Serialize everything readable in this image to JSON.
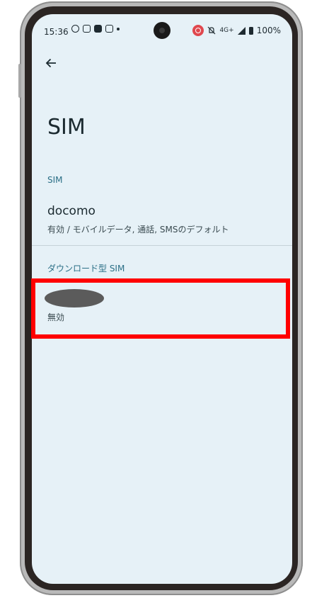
{
  "status_bar": {
    "time": "15:36",
    "network": "4G+",
    "battery": "100%",
    "left_icons": [
      "location-icon",
      "docomo-d-icon",
      "teams-icon",
      "docomo-d-icon",
      "dot-icon"
    ],
    "right_icons": [
      "screen-record-icon",
      "alarm-off-icon",
      "signal-icon",
      "battery-icon"
    ]
  },
  "header": {
    "back_icon": "arrow-left-icon",
    "title": "SIM"
  },
  "sections": [
    {
      "header": "SIM",
      "items": [
        {
          "title": "docomo",
          "subtitle": "有効 / モバイルデータ, 通話, SMSのデフォルト"
        }
      ]
    },
    {
      "header": "ダウンロード型 SIM",
      "items": [
        {
          "title": "",
          "subtitle": "無効"
        }
      ]
    }
  ],
  "colors": {
    "screen_bg": "#e6f1f7",
    "section_header": "#2b6f86",
    "highlight": "#ff0000"
  }
}
